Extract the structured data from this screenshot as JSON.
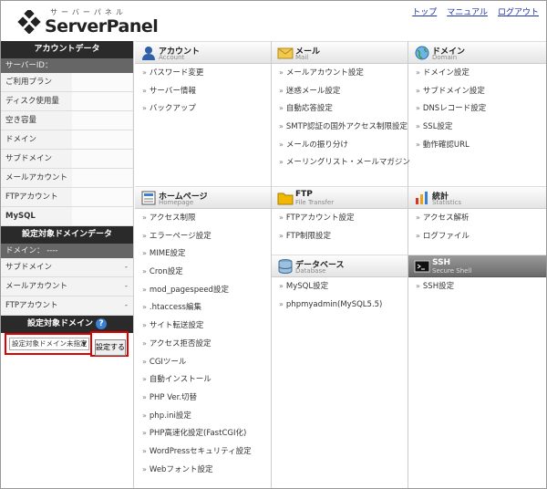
{
  "header": {
    "logo_ja": "サーバーパネル",
    "logo_en": "ServerPanel",
    "nav": [
      "トップ",
      "マニュアル",
      "ログアウト"
    ]
  },
  "sidebar": {
    "account_title": "アカウントデータ",
    "server_id_label": "サーバーID：",
    "account_rows": [
      "ご利用プラン",
      "ディスク使用量",
      "空き容量",
      "ドメイン",
      "サブドメイン",
      "メールアカウント",
      "FTPアカウント",
      "MySQL"
    ],
    "domain_data_title": "設定対象ドメインデータ",
    "domain_label": "ドメイン： ----",
    "domain_rows": [
      {
        "label": "サブドメイン",
        "value": "-"
      },
      {
        "label": "メールアカウント",
        "value": "-"
      },
      {
        "label": "FTPアカウント",
        "value": "-"
      }
    ],
    "target_domain_title": "設定対象ドメイン",
    "help_icon": "?",
    "select_value": "設定対象ドメイン未指定",
    "select_caret": "▼",
    "set_button": "設定する"
  },
  "sections": {
    "account": {
      "title": "アカウント",
      "sub": "Account",
      "icon": "user-icon",
      "items": [
        "パスワード変更",
        "サーバー情報",
        "バックアップ"
      ]
    },
    "mail": {
      "title": "メール",
      "sub": "Mail",
      "icon": "envelope-icon",
      "items": [
        "メールアカウント設定",
        "迷惑メール設定",
        "自動応答設定",
        "SMTP認証の国外アクセス制限設定",
        "メールの振り分け",
        "メーリングリスト・メールマガジン"
      ]
    },
    "domain": {
      "title": "ドメイン",
      "sub": "Domain",
      "icon": "globe-icon",
      "items": [
        "ドメイン設定",
        "サブドメイン設定",
        "DNSレコード設定",
        "SSL設定",
        "動作確認URL"
      ]
    },
    "homepage": {
      "title": "ホームページ",
      "sub": "Homepage",
      "icon": "document-icon",
      "items": [
        "アクセス制限",
        "エラーページ設定",
        "MIME設定",
        "Cron設定",
        "mod_pagespeed設定",
        ".htaccess編集",
        "サイト転送設定",
        "アクセス拒否設定",
        "CGIツール",
        "自動インストール",
        "PHP Ver.切替",
        "php.ini設定",
        "PHP高速化設定(FastCGI化)",
        "WordPressセキュリティ設定",
        "Webフォント設定"
      ]
    },
    "ftp": {
      "title": "FTP",
      "sub": "File Transfer",
      "icon": "folder-icon",
      "items": [
        "FTPアカウント設定",
        "FTP制限設定"
      ]
    },
    "stats": {
      "title": "統計",
      "sub": "Statistics",
      "icon": "bar-chart-icon",
      "items": [
        "アクセス解析",
        "ログファイル"
      ]
    },
    "database": {
      "title": "データベース",
      "sub": "Database",
      "icon": "database-icon",
      "items": [
        "MySQL設定",
        "phpmyadmin(MySQL5.5)"
      ]
    },
    "ssh": {
      "title": "SSH",
      "sub": "Secure Shell",
      "icon": "terminal-icon",
      "items": [
        "SSH設定"
      ]
    }
  }
}
